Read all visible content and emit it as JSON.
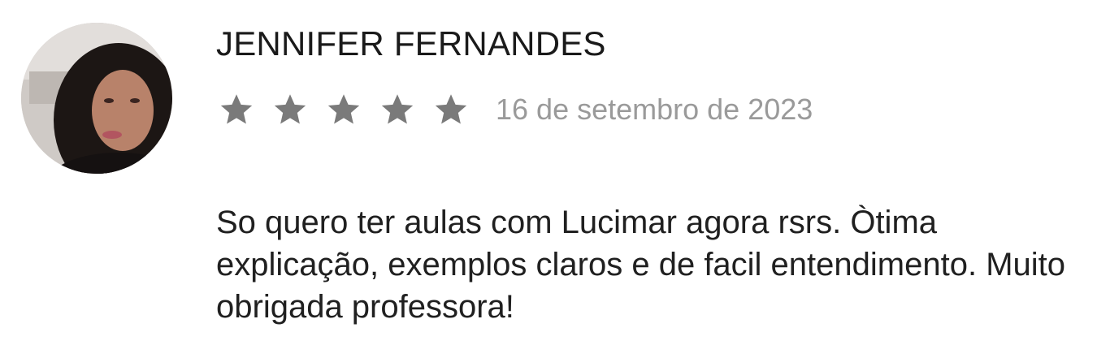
{
  "review": {
    "author": "JENNIFER FERNANDES",
    "rating": 5,
    "rating_max": 5,
    "date": "16 de setembro de 2023",
    "text": "So quero ter aulas com Lucimar agora rsrs. Òtima explicação, exemplos claros e de facil entendimento. Muito obrigada professora!"
  },
  "colors": {
    "star": "#7a7a7a",
    "name": "#1a1a1a",
    "date": "#9a9a9a",
    "text": "#202020"
  },
  "icons": {
    "star": "star-icon",
    "avatar": "avatar"
  }
}
